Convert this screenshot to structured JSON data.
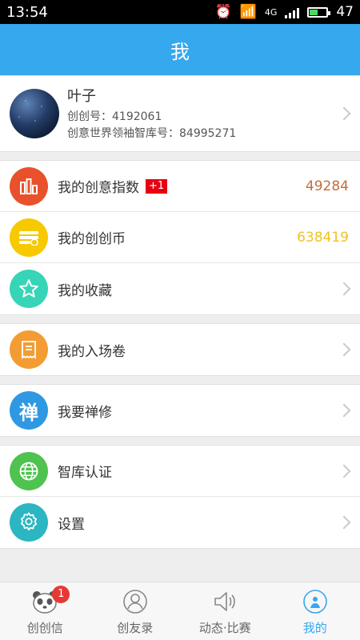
{
  "status": {
    "time": "13:54",
    "network": "4G",
    "battery": "47"
  },
  "header": {
    "title": "我"
  },
  "profile": {
    "name": "叶子",
    "id_line": "创创号：4192061",
    "account_line": "创意世界领袖智库号：84995271"
  },
  "menu": {
    "index": {
      "label": "我的创意指数",
      "badge": "+1",
      "value": "49284",
      "color": "#c56d3c"
    },
    "coins": {
      "label": "我的创创币",
      "value": "638419",
      "color": "#f2c223"
    },
    "favorites": {
      "label": "我的收藏"
    },
    "tickets": {
      "label": "我的入场卷"
    },
    "chan": {
      "label": "我要禅修",
      "icon_char": "禅"
    },
    "think_tank": {
      "label": "智库认证"
    },
    "settings": {
      "label": "设置"
    }
  },
  "colors": {
    "brand": "#35a8ee",
    "index_icon": "#e8512c",
    "coins_icon": "#f7c900",
    "favorites_icon": "#37d5b7",
    "tickets_icon": "#f39c33",
    "chan_icon": "#2f98e2",
    "think_tank_icon": "#4fc24f",
    "settings_icon": "#2bb6c1"
  },
  "tabs": {
    "chuangxin": {
      "label": "创创信",
      "badge": "1"
    },
    "friends": {
      "label": "创友录"
    },
    "dynamics": {
      "label": "动态·比赛"
    },
    "mine": {
      "label": "我的"
    }
  }
}
